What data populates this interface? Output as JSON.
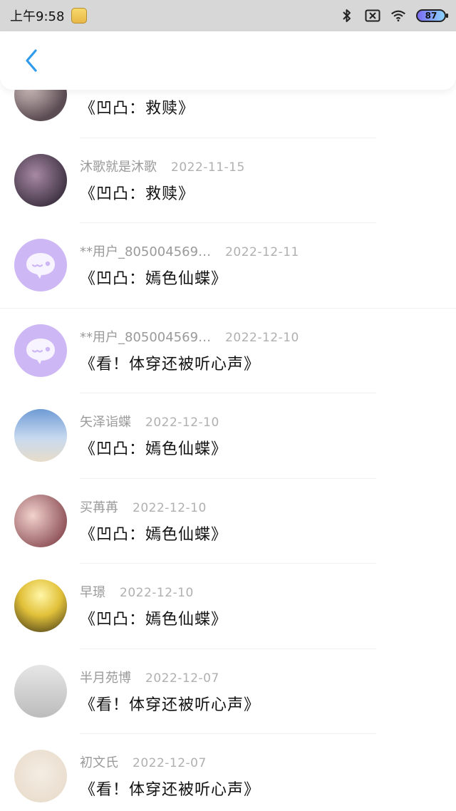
{
  "status_bar": {
    "time": "上午9:58",
    "battery": "87",
    "icons": [
      "mascot-icon",
      "bluetooth-icon",
      "sim-off-icon",
      "wifi-icon",
      "battery-icon"
    ]
  },
  "header": {
    "back_icon": "chevron-left-icon",
    "accent_color": "#2f9bea"
  },
  "comments": [
    {
      "name": "",
      "date": "",
      "title": "《凹凸：救赎》",
      "avatar": "photo"
    },
    {
      "name": "沐歌就是沐歌",
      "date": "2022-11-15",
      "title": "《凹凸：救赎》",
      "avatar": "photo"
    },
    {
      "name": "**用户_805004569…",
      "date": "2022-12-11",
      "title": "《凹凸：嫣色仙蝶》",
      "avatar": "default"
    },
    {
      "name": "**用户_805004569…",
      "date": "2022-12-10",
      "title": "《看！体穿还被听心声》",
      "avatar": "default"
    },
    {
      "name": "矢泽诣蝶",
      "date": "2022-12-10",
      "title": "《凹凸：嫣色仙蝶》",
      "avatar": "photo"
    },
    {
      "name": "买苒苒",
      "date": "2022-12-10",
      "title": "《凹凸：嫣色仙蝶》",
      "avatar": "photo"
    },
    {
      "name": "早璟",
      "date": "2022-12-10",
      "title": "《凹凸：嫣色仙蝶》",
      "avatar": "photo"
    },
    {
      "name": "半月苑博",
      "date": "2022-12-07",
      "title": "《看！体穿还被听心声》",
      "avatar": "photo"
    },
    {
      "name": "初文氏",
      "date": "2022-12-07",
      "title": "《看！体穿还被听心声》",
      "avatar": "photo"
    }
  ]
}
